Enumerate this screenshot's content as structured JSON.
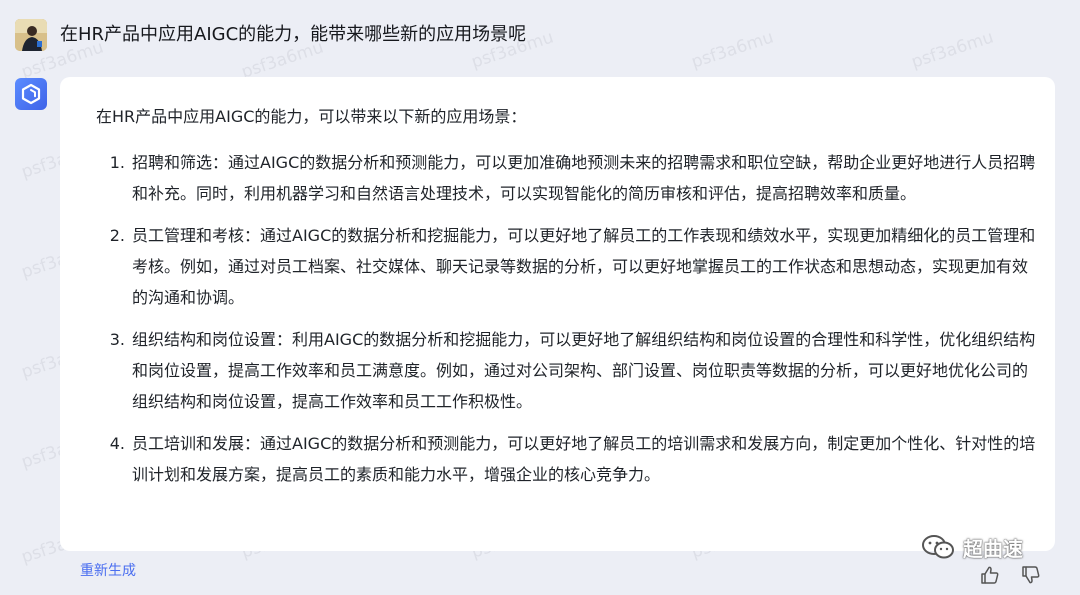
{
  "question": "在HR产品中应用AIGC的能力，能带来哪些新的应用场景呢",
  "answer": {
    "intro": "在HR产品中应用AIGC的能力，可以带来以下新的应用场景：",
    "items": [
      {
        "num": "1.",
        "text": "招聘和筛选：通过AIGC的数据分析和预测能力，可以更加准确地预测未来的招聘需求和职位空缺，帮助企业更好地进行人员招聘和补充。同时，利用机器学习和自然语言处理技术，可以实现智能化的简历审核和评估，提高招聘效率和质量。"
      },
      {
        "num": "2.",
        "text": "员工管理和考核：通过AIGC的数据分析和挖掘能力，可以更好地了解员工的工作表现和绩效水平，实现更加精细化的员工管理和考核。例如，通过对员工档案、社交媒体、聊天记录等数据的分析，可以更好地掌握员工的工作状态和思想动态，实现更加有效的沟通和协调。"
      },
      {
        "num": "3.",
        "text": "组织结构和岗位设置：利用AIGC的数据分析和挖掘能力，可以更好地了解组织结构和岗位设置的合理性和科学性，优化组织结构和岗位设置，提高工作效率和员工满意度。例如，通过对公司架构、部门设置、岗位职责等数据的分析，可以更好地优化公司的组织结构和岗位设置，提高工作效率和员工工作积极性。"
      },
      {
        "num": "4.",
        "text": "员工培训和发展：通过AIGC的数据分析和预测能力，可以更好地了解员工的培训需求和发展方向，制定更加个性化、针对性的培训计划和发展方案，提高员工的素质和能力水平，增强企业的核心竞争力。"
      }
    ]
  },
  "actions": {
    "regenerate": "重新生成",
    "like_icon": "thumbs-up-icon",
    "dislike_icon": "thumbs-down-icon"
  },
  "brand": {
    "text": "超曲速"
  },
  "watermark": "psf3a6mu",
  "colors": {
    "accent": "#4a6ef0",
    "background": "#eceef5",
    "card": "#ffffff"
  }
}
